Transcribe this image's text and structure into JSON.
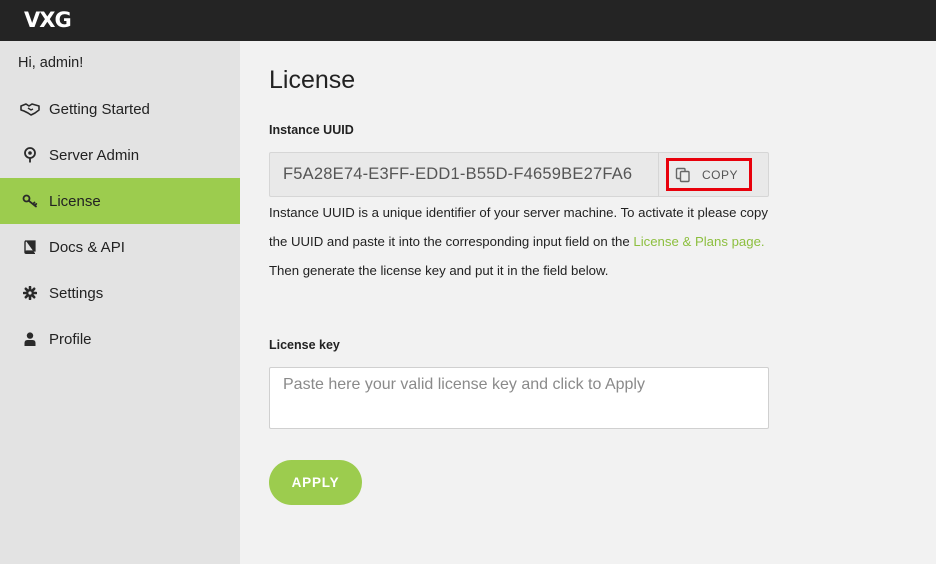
{
  "header": {
    "logo": "VXG"
  },
  "sidebar": {
    "greeting": "Hi, admin!",
    "items": [
      {
        "label": "Getting Started",
        "icon": "handshake-icon",
        "active": false
      },
      {
        "label": "Server Admin",
        "icon": "location-pin-icon",
        "active": false
      },
      {
        "label": "License",
        "icon": "key-icon",
        "active": true
      },
      {
        "label": "Docs & API",
        "icon": "book-icon",
        "active": false
      },
      {
        "label": "Settings",
        "icon": "gear-icon",
        "active": false
      },
      {
        "label": "Profile",
        "icon": "user-icon",
        "active": false
      }
    ]
  },
  "main": {
    "title": "License",
    "uuid": {
      "label": "Instance UUID",
      "value": "F5A28E74-E3FF-EDD1-B55D-F4659BE27FA6",
      "copy_label": "COPY"
    },
    "description": {
      "part1": "Instance UUID is a unique identifier of your server machine. To activate it please copy the UUID and paste it into the corresponding input field on the ",
      "link": "License & Plans page.",
      "part2": " Then generate the license key and put it in the field below."
    },
    "license_key": {
      "label": "License key",
      "placeholder": "Paste here your valid license key and click to Apply",
      "value": ""
    },
    "apply_label": "APPLY"
  },
  "colors": {
    "accent": "#9ccc4e",
    "topbar": "#242424",
    "sidebar": "#e3e3e3",
    "highlight_border": "#e8000b",
    "link": "#8dbf3f"
  }
}
